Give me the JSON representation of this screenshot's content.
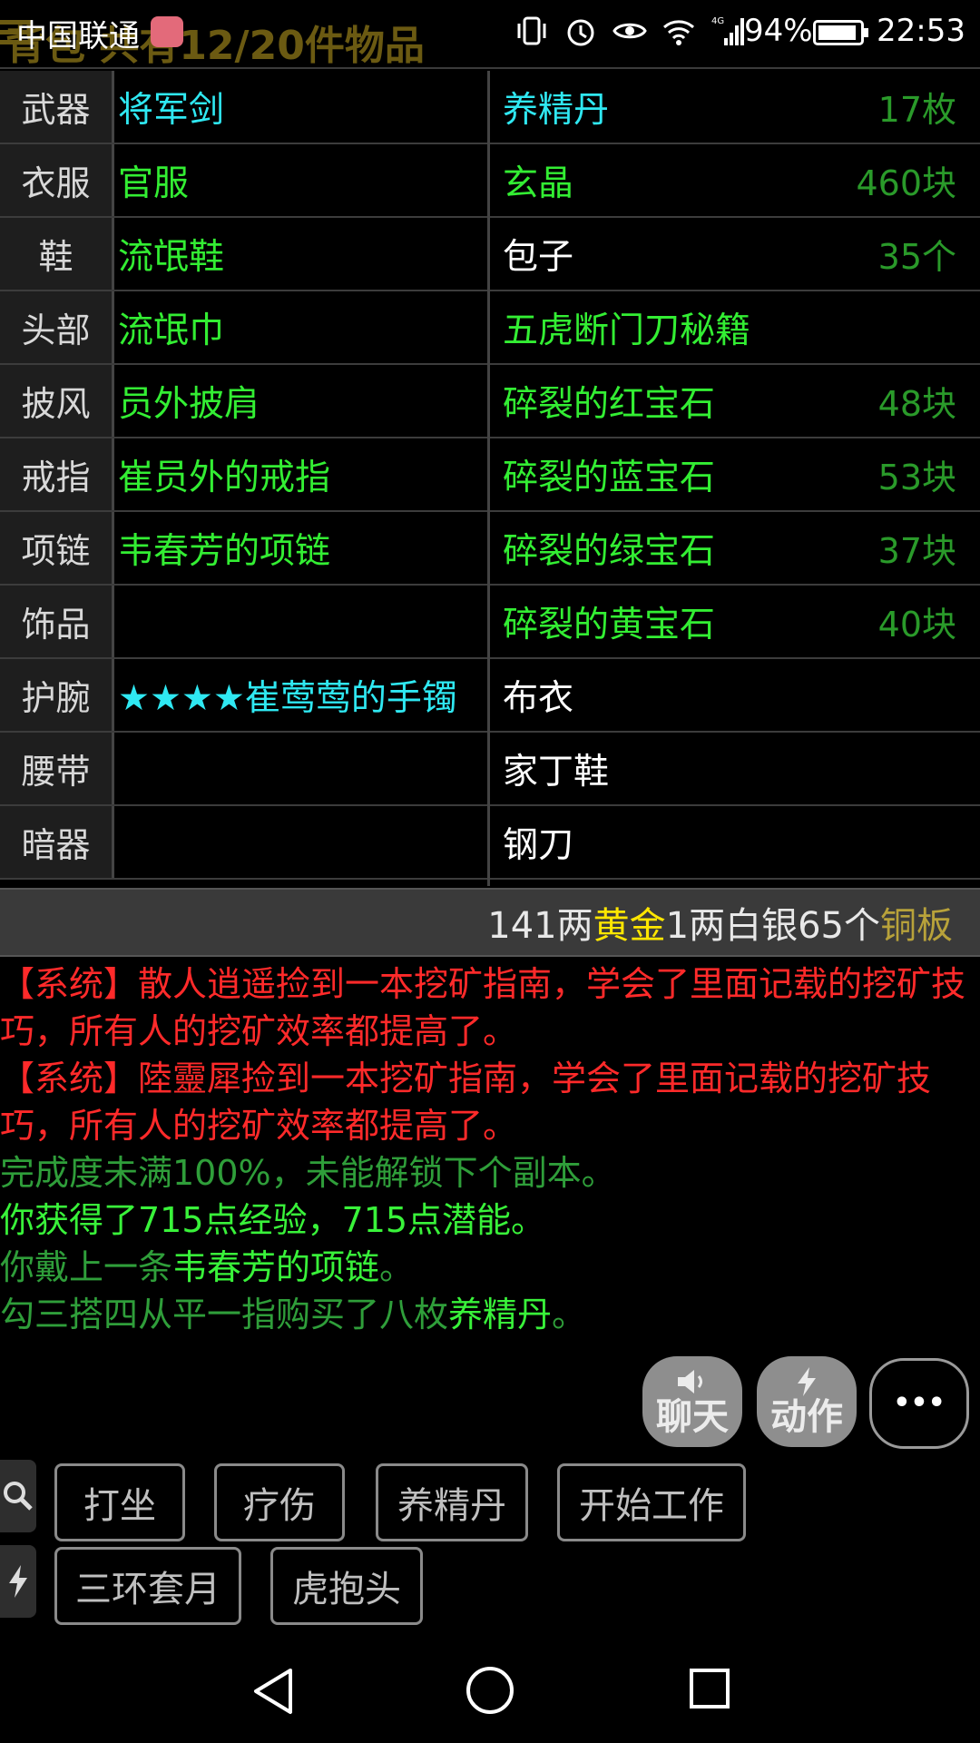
{
  "status_bar": {
    "carrier": "中国联通",
    "battery_percent": "94%",
    "battery_level": 0.94,
    "time": "22:53",
    "icons": [
      "vibrate-icon",
      "alarm-icon",
      "eye-icon",
      "wifi-icon",
      "4g-signal-icon"
    ]
  },
  "header": {
    "title_partial": "背包 共有12/20件物品"
  },
  "equipment": [
    {
      "slot": "武器",
      "item": "将军剑",
      "color": "cyan"
    },
    {
      "slot": "衣服",
      "item": "官服",
      "color": "green"
    },
    {
      "slot": "鞋",
      "item": "流氓鞋",
      "color": "green"
    },
    {
      "slot": "头部",
      "item": "流氓巾",
      "color": "green"
    },
    {
      "slot": "披风",
      "item": "员外披肩",
      "color": "green"
    },
    {
      "slot": "戒指",
      "item": "崔员外的戒指",
      "color": "green"
    },
    {
      "slot": "项链",
      "item": "韦春芳的项链",
      "color": "green"
    },
    {
      "slot": "饰品",
      "item": "",
      "color": "green"
    },
    {
      "slot": "护腕",
      "item": "★★★★崔莺莺的手镯",
      "color": "cyan"
    },
    {
      "slot": "腰带",
      "item": "",
      "color": "green"
    },
    {
      "slot": "暗器",
      "item": "",
      "color": "green"
    }
  ],
  "inventory": [
    {
      "name": "养精丹",
      "qty": "17枚",
      "color": "cyan"
    },
    {
      "name": "玄晶",
      "qty": "460块",
      "color": "green"
    },
    {
      "name": "包子",
      "qty": "35个",
      "color": "white"
    },
    {
      "name": "五虎断门刀秘籍",
      "qty": "",
      "color": "green"
    },
    {
      "name": "碎裂的红宝石",
      "qty": "48块",
      "color": "green"
    },
    {
      "name": "碎裂的蓝宝石",
      "qty": "53块",
      "color": "green"
    },
    {
      "name": "碎裂的绿宝石",
      "qty": "37块",
      "color": "green"
    },
    {
      "name": "碎裂的黄宝石",
      "qty": "40块",
      "color": "green"
    },
    {
      "name": "布衣",
      "qty": "",
      "color": "white"
    },
    {
      "name": "家丁鞋",
      "qty": "",
      "color": "white"
    },
    {
      "name": "钢刀",
      "qty": "",
      "color": "white"
    }
  ],
  "money": {
    "gold_amount": "141两",
    "gold_label": "黄金",
    "silver": "1两白银",
    "copper_amount": "65个",
    "copper_label": "铜板"
  },
  "log": {
    "line1": "【系统】散人逍遥捡到一本挖矿指南，学会了里面记载的挖矿技巧，所有人的挖矿效率都提高了。",
    "line2": "【系统】陸靈犀捡到一本挖矿指南，学会了里面记载的挖矿技巧，所有人的挖矿效率都提高了。",
    "line3": "完成度未满100%，未能解锁下个副本。",
    "line4": "你获得了715点经验，715点潜能。",
    "line5_prefix": "你戴上一条",
    "line5_item": "韦春芳的项链",
    "line5_suffix": "。",
    "line6_prefix": "勾三搭四从平一指购买了八枚",
    "line6_item": "养精丹",
    "line6_suffix": "。"
  },
  "actions": {
    "chat": "聊天",
    "action": "动作",
    "more": "•••"
  },
  "quick_buttons": {
    "row1": [
      "打坐",
      "疗伤",
      "养精丹",
      "开始工作"
    ],
    "row2": [
      "三环套月",
      "虎抱头"
    ]
  },
  "colors": {
    "green": "#33ee33",
    "cyan": "#2fe8f2",
    "system_red": "#ff2a2a",
    "gold": "#ffe600"
  }
}
